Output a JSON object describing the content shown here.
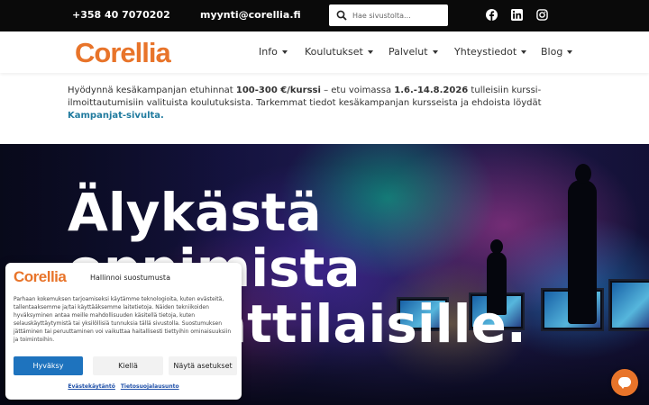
{
  "topbar": {
    "phone": "+358 40 7070202",
    "email": "myynti@corellia.fi",
    "search_placeholder": "Hae sivustolta...",
    "social_icons": [
      "facebook-icon",
      "linkedin-icon",
      "instagram-icon"
    ]
  },
  "nav": {
    "logo": "Corellia",
    "items": [
      {
        "label": "Info"
      },
      {
        "label": "Koulutukset"
      },
      {
        "label": "Palvelut"
      },
      {
        "label": "Yhteystiedot"
      },
      {
        "label": "Blog"
      }
    ]
  },
  "notice": {
    "t1": "Hyödynnä kesäkampanjan etuhinnat ",
    "b1": "100-300 €/kurssi",
    "t2": " – etu voimassa ",
    "b2": "1.6.-14.8.2026",
    "t3": " tulleisiin kurssi-ilmoittautumisiin valituista koulutuksista. Tarkemmat tiedot kesäkampanjan kursseista ja ehdoista löydät ",
    "link": "Kampanjat-sivulta."
  },
  "hero": {
    "title": "Älykästä oppimista ammattilaisille."
  },
  "cookie": {
    "logo": "Corellia",
    "title": "Hallinnoi suostumusta",
    "text": "Parhaan kokemuksen tarjoamiseksi käytämme teknologioita, kuten evästeitä, tallentaaksemme ja/tai käyttääksemme laitetietoja. Näiden tekniikoiden hyväksyminen antaa meille mahdollisuuden käsitellä tietoja, kuten selauskäyttäytymistä tai yksilöllisiä tunnuksia tällä sivustolla. Suostumuksen jättäminen tai peruuttaminen voi vaikuttaa haitallisesti tiettyihin ominaisuuksiin ja toimintoihin.",
    "accept": "Hyväksy",
    "deny": "Kiellä",
    "settings": "Näytä asetukset",
    "link_cookies": "Evästekäytäntö",
    "link_privacy": "Tietosuojalausunto"
  },
  "colors": {
    "brand": "#e8742a",
    "topbar": "#0a0a0a",
    "link": "#1f7a9e",
    "button": "#1e73be"
  }
}
